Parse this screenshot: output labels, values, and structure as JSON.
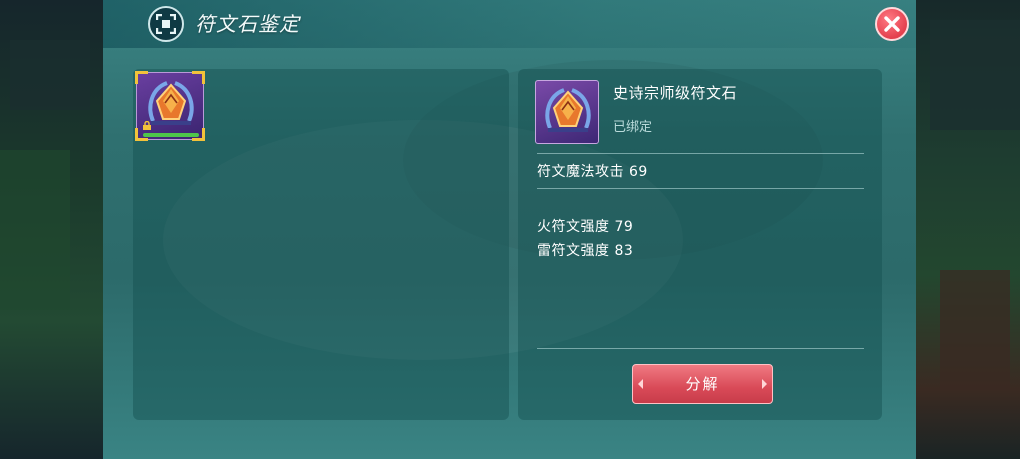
{
  "window": {
    "title": "符文石鉴定",
    "title_icon": "scan-icon",
    "close_icon": "close-icon"
  },
  "inventory": {
    "slots": [
      {
        "item": "rune-stone",
        "icon": "rune-gem-icon",
        "bound": true,
        "selected": true
      }
    ]
  },
  "detail": {
    "item_name": "史诗宗师级符文石",
    "bind_status": "已绑定",
    "primary_stat": "符文魔法攻击 69",
    "secondary_stats": [
      "火符文强度 79",
      "雷符文强度 83"
    ],
    "decompose_label": "分解"
  },
  "colors": {
    "panel": "#2f7070",
    "accent_gold": "#f2c23a",
    "button_red": "#d94a58",
    "rarity_purple": "#6a3fa0"
  }
}
